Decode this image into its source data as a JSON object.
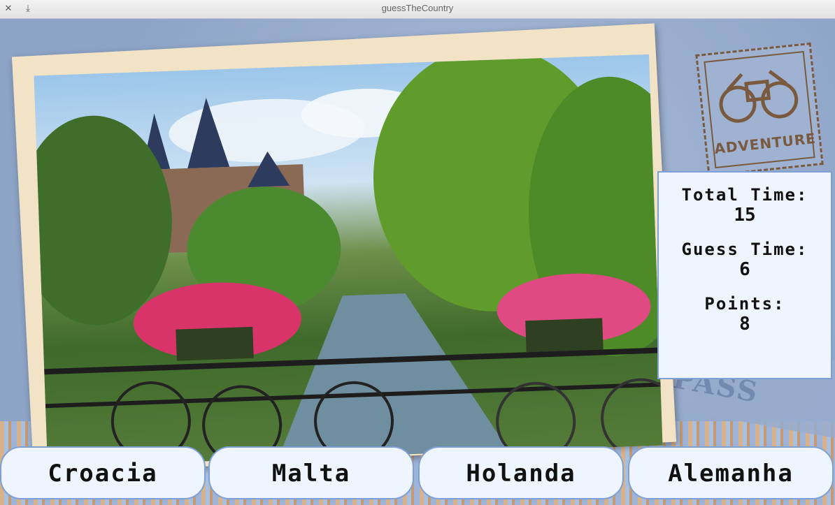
{
  "window": {
    "title": "guessTheCountry",
    "close_glyph": "✕",
    "pin_glyph": "⤓"
  },
  "stamp": {
    "label": "ADVENTURE",
    "icon": "binoculars-icon"
  },
  "pass": {
    "text": "PASS"
  },
  "score": {
    "total_time_label": "Total Time:",
    "total_time_value": "15",
    "guess_time_label": "Guess Time:",
    "guess_time_value": "6",
    "points_label": "Points:",
    "points_value": "8"
  },
  "answers": [
    "Croacia",
    "Malta",
    "Holanda",
    "Alemanha"
  ],
  "colors": {
    "panel_bg": "#eef5ff",
    "panel_border": "#7fa0d6",
    "stamp_brown": "#7a5a3e"
  }
}
